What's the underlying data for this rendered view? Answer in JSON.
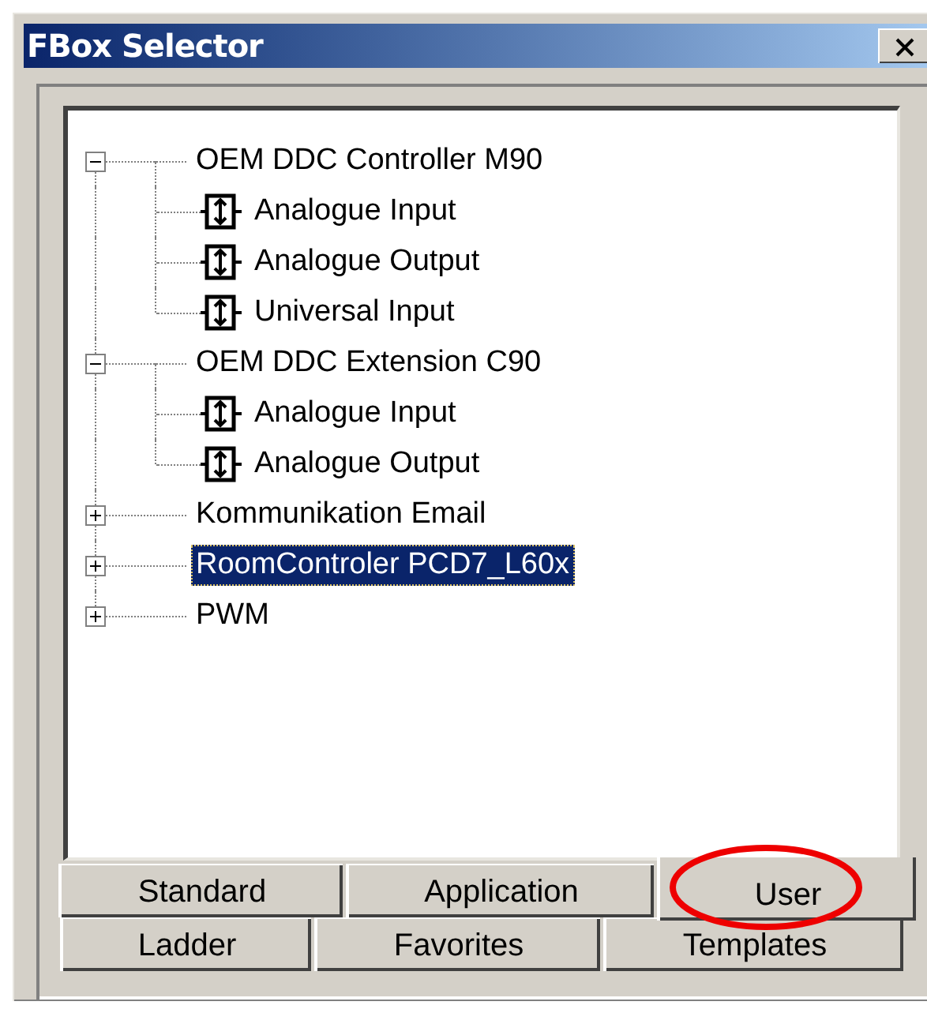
{
  "window": {
    "title": "FBox Selector"
  },
  "tree": [
    {
      "label": "OEM DDC Controller M90",
      "expanded": true,
      "selected": false,
      "children": [
        {
          "label": "Analogue Input",
          "selected": false
        },
        {
          "label": "Analogue Output",
          "selected": false
        },
        {
          "label": "Universal Input",
          "selected": false
        }
      ]
    },
    {
      "label": "OEM DDC Extension C90",
      "expanded": true,
      "selected": false,
      "children": [
        {
          "label": "Analogue Input",
          "selected": false
        },
        {
          "label": "Analogue Output",
          "selected": false
        }
      ]
    },
    {
      "label": "Kommunikation Email",
      "expanded": false,
      "selected": false
    },
    {
      "label": "RoomControler PCD7_L60x",
      "expanded": false,
      "selected": true
    },
    {
      "label": "PWM",
      "expanded": false,
      "selected": false
    }
  ],
  "tab_rows": [
    [
      {
        "label": "Standard",
        "selected": false
      },
      {
        "label": "Application",
        "selected": false
      },
      {
        "label": "User",
        "selected": true,
        "circled": true
      }
    ],
    [
      {
        "label": "Ladder",
        "selected": false
      },
      {
        "label": "Favorites",
        "selected": false
      },
      {
        "label": "Templates",
        "selected": false
      }
    ]
  ]
}
